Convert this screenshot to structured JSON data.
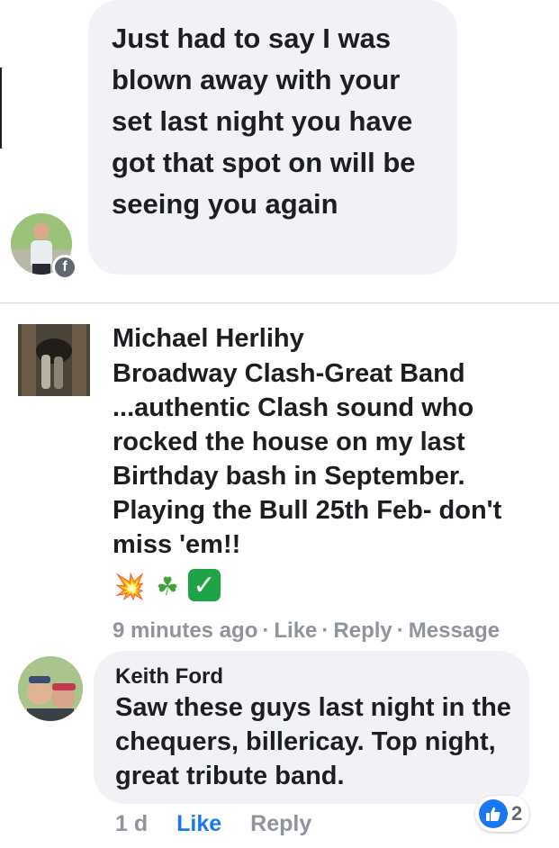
{
  "comment_top": {
    "text": "Just had to say I was blown away with your set last night you have got that spot on will be seeing you again"
  },
  "comment_michael": {
    "author": "Michael Herlihy",
    "text": "Broadway Clash-Great Band ...authentic Clash sound who rocked the house on my last Birthday bash in September.  Playing the Bull 25th Feb- don't miss 'em!!",
    "emojis": [
      "💥",
      "☘",
      "✓"
    ],
    "time": "9 minutes ago",
    "like_label": "Like",
    "reply_label": "Reply",
    "message_label": "Message"
  },
  "comment_keith": {
    "author": "Keith Ford",
    "text": "Saw these guys last night in the chequers, billericay. Top night, great tribute band.",
    "time": "1 d",
    "like_label": "Like",
    "reply_label": "Reply",
    "reaction_count": "2"
  },
  "colors": {
    "bubble": "#f0f2f5",
    "link_blue": "#1877f2",
    "meta_gray": "#90949c"
  }
}
